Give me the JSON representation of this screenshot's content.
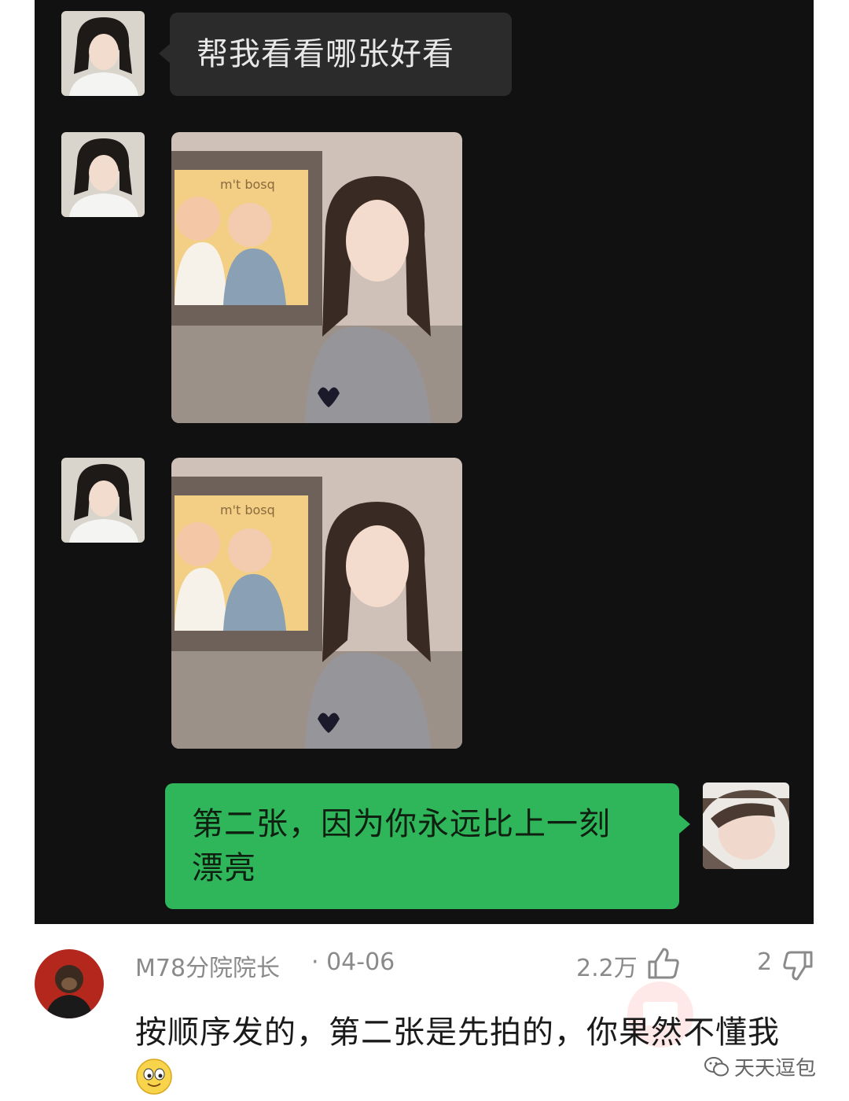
{
  "chat": {
    "message_1": "帮我看看哪张好看",
    "message_2_line1": "第二张，因为你永远比上一刻",
    "message_2_line2": "漂亮"
  },
  "photo_poster_text": "m't bosq",
  "comment": {
    "username": "M78分院院长",
    "date": "· 04-06",
    "likes": "2.2万",
    "dislikes": "2",
    "text": "按顺序发的，第二张是先拍的，你果然不懂我"
  },
  "watermark": {
    "text": "天天逗包"
  },
  "colors": {
    "chat_background": "#111111",
    "gray_bubble": "#2b2b2b",
    "green_bubble": "#2fb55a",
    "meta_text": "#8a8a8a"
  },
  "icons": [
    "thumbs-up-icon",
    "thumbs-down-icon",
    "smile-emoji-icon",
    "wechat-logo-icon"
  ]
}
